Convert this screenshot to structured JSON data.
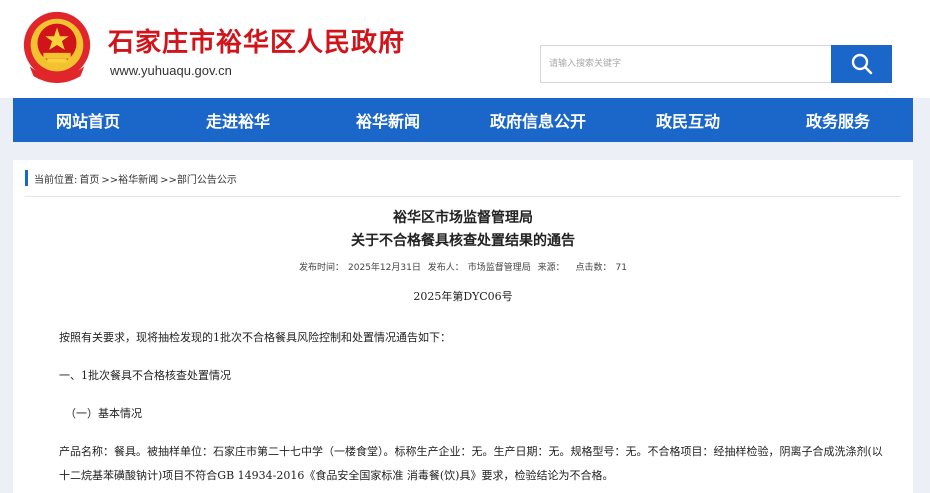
{
  "header": {
    "site_title": "石家庄市裕华区人民政府",
    "site_domain": "www.yuhuaqu.gov.cn",
    "search_placeholder": "请输入搜索关键字"
  },
  "nav": {
    "items": [
      "网站首页",
      "走进裕华",
      "裕华新闻",
      "政府信息公开",
      "政民互动",
      "政务服务"
    ]
  },
  "breadcrumb": {
    "label": "当前位置:",
    "path": [
      "首页",
      ">>裕华新闻",
      ">>部门公告公示"
    ]
  },
  "article": {
    "title_line1": "裕华区市场监督管理局",
    "title_line2": "关于不合格餐具核查处置结果的通告",
    "publish_label": "发布时间：",
    "publish_date": "2025年12月31日",
    "publisher_label": "发布人：",
    "publisher": "市场监督管理局",
    "source_label": "来源：",
    "source": "",
    "clicks_label": "点击数：",
    "clicks": "71",
    "doc_number": "2025年第DYC06号",
    "paragraphs": [
      "按照有关要求，现将抽检发现的1批次不合格餐具风险控制和处置情况通告如下：",
      "一、1批次餐具不合格核查处置情况",
      "（一）基本情况",
      "产品名称：餐具。被抽样单位：石家庄市第二十七中学（一楼食堂）。标称生产企业：无。生产日期：无。规格型号：无。不合格项目：经抽样检验，阴离子合成洗涤剂(以十二烷基苯磺酸钠计)项目不符合GB 14934-2016《食品安全国家标准 消毒餐(饮)具》要求，检验结论为不合格。"
    ]
  },
  "colors": {
    "brand_red": "#d0141a",
    "nav_blue": "#1b66c9",
    "page_bg": "#ecf0f6"
  }
}
